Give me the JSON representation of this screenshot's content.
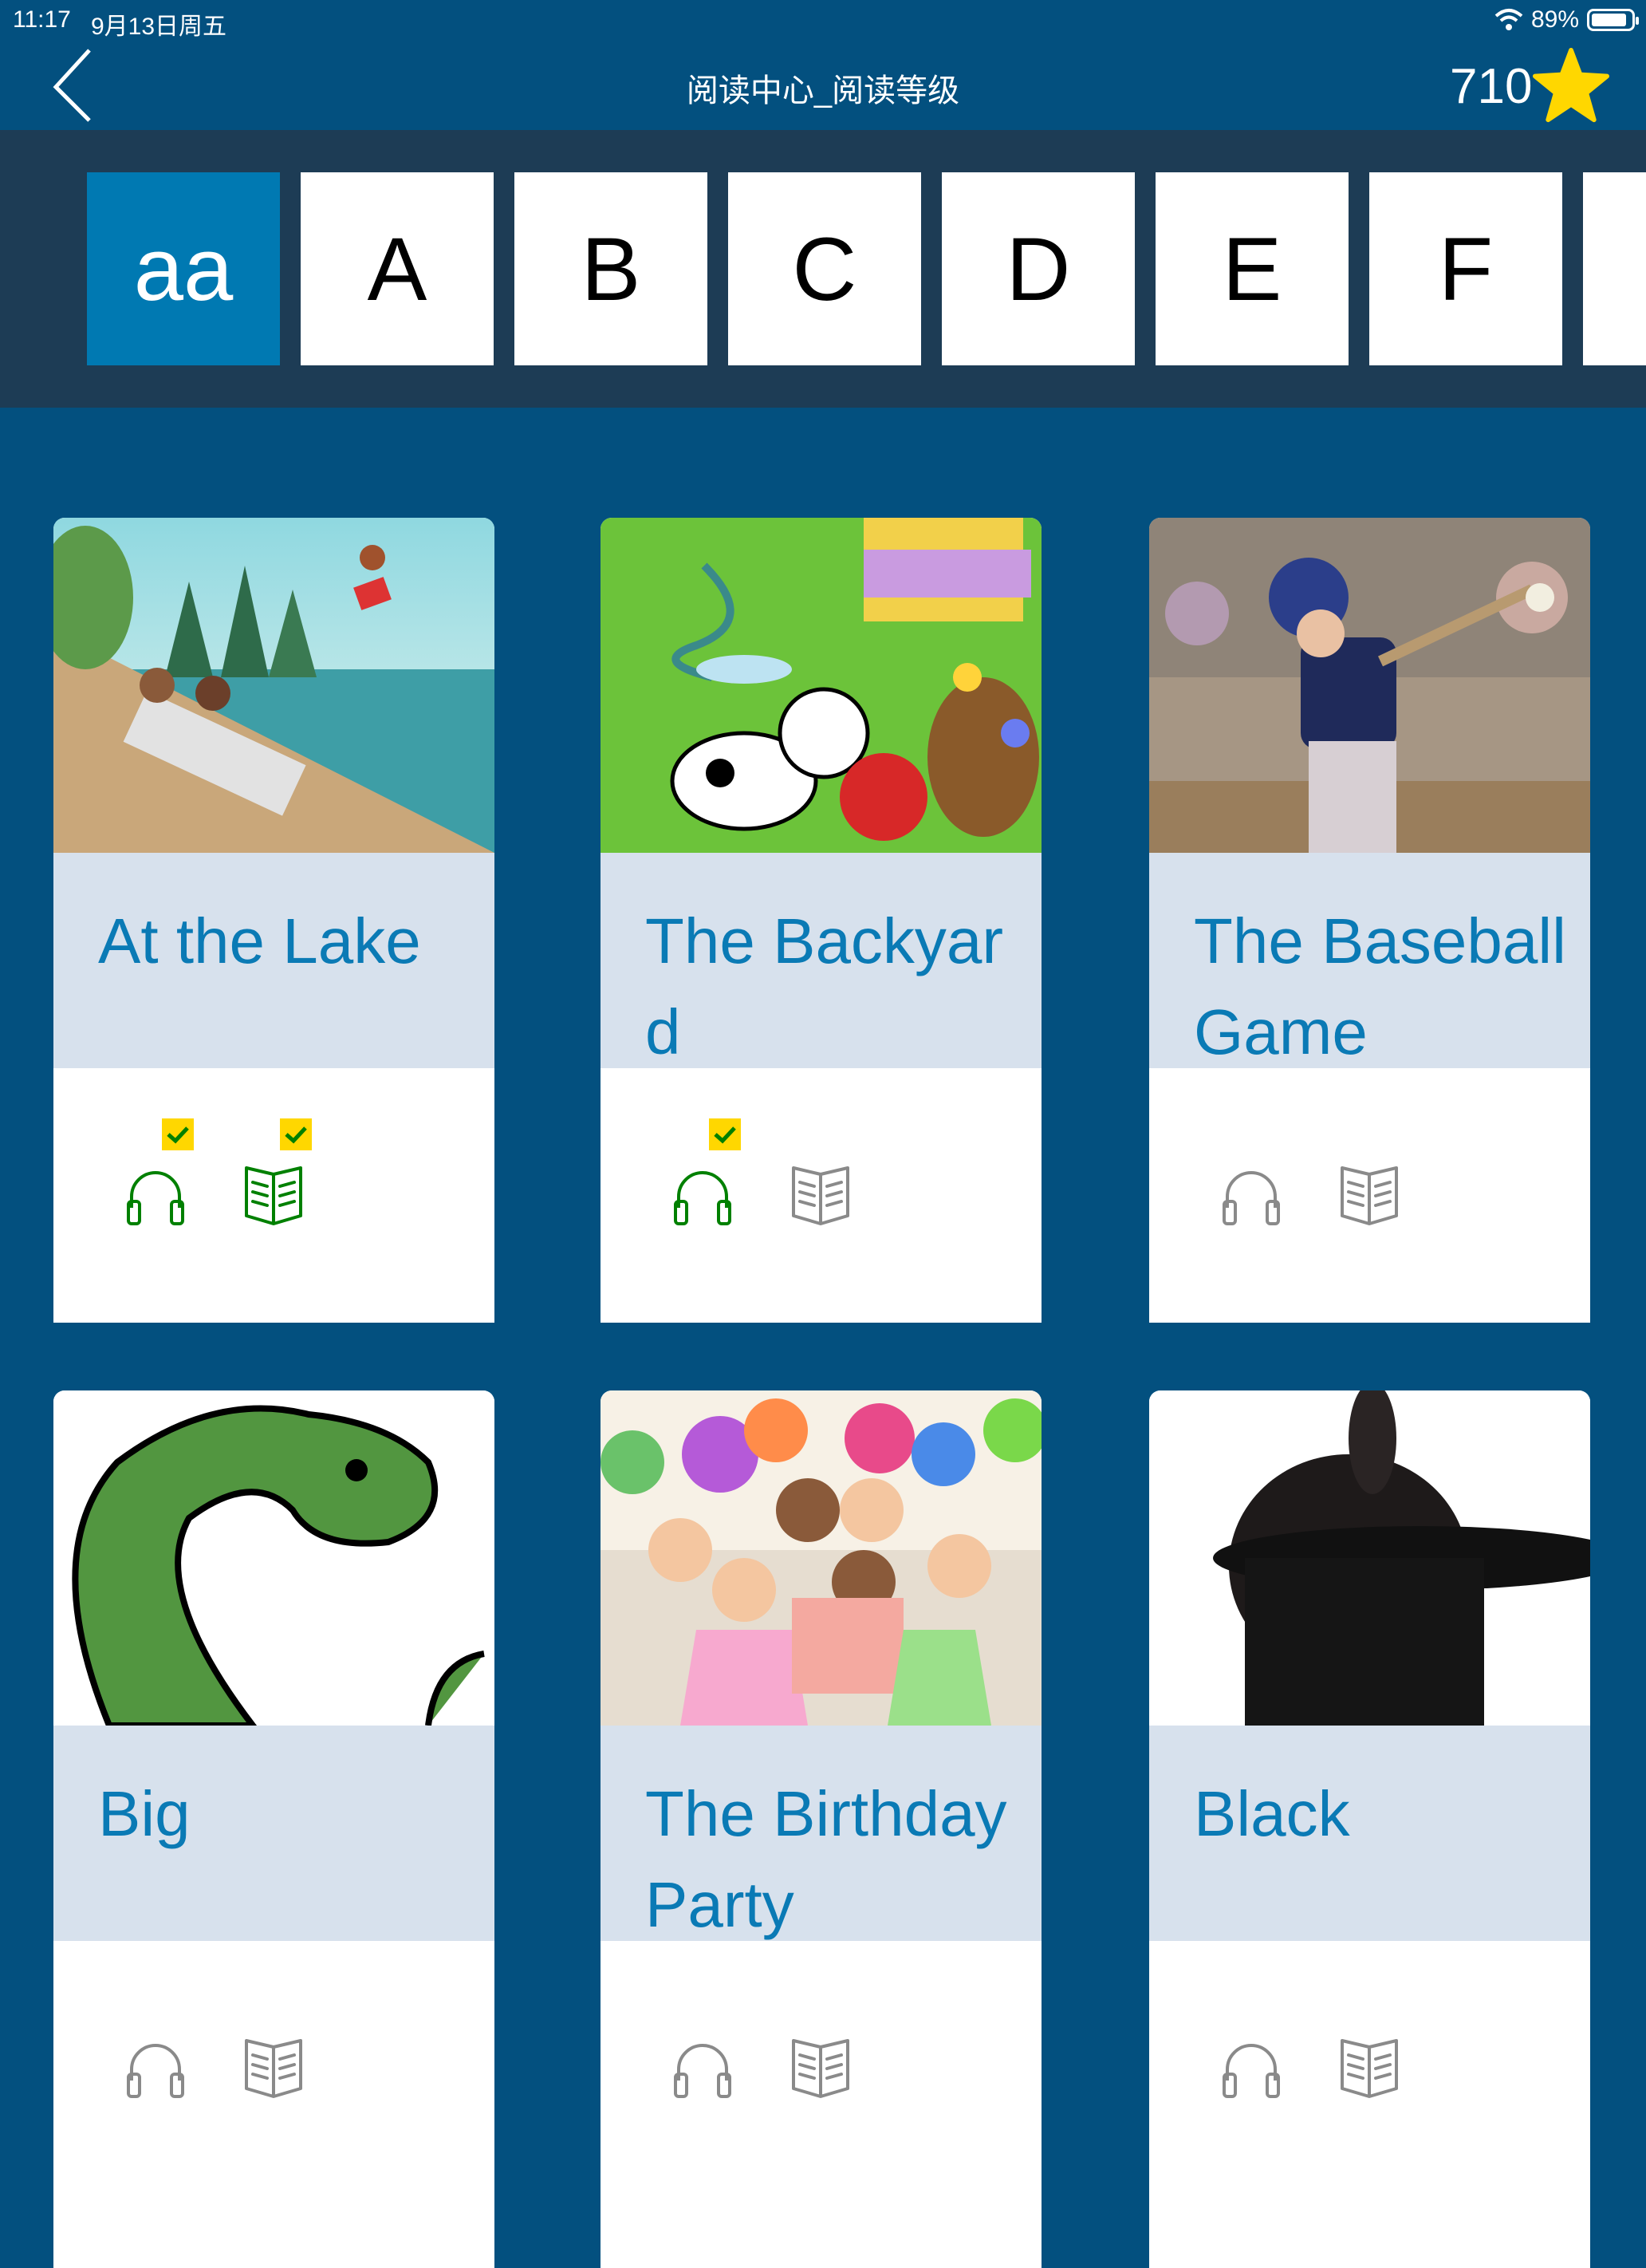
{
  "status_bar": {
    "time": "11:17",
    "date": "9月13日周五",
    "battery": "89%",
    "battery_level": 0.89
  },
  "nav": {
    "title": "阅读中心_阅读等级",
    "score": "710",
    "back_icon": "chevron-left-icon",
    "score_icon": "star-icon"
  },
  "levels": {
    "selected": "aa",
    "items": [
      "aa",
      "A",
      "B",
      "C",
      "D",
      "E",
      "F",
      ""
    ]
  },
  "colors": {
    "nav_bg": "#03507f",
    "level_bar": "#1d3c55",
    "selected_tile": "#0079b2",
    "title_bg": "#d7e1ed",
    "title_text": "#0a7ab5",
    "done": "#008000",
    "pending": "#8a8a8a",
    "badge": "#ffd700",
    "star": "#ffd700"
  },
  "books": [
    {
      "title": "At the Lake",
      "listened": true,
      "read": true
    },
    {
      "title": "The Backyard",
      "listened": true,
      "read": false
    },
    {
      "title": "The Baseball Game",
      "listened": false,
      "read": false
    },
    {
      "title": "Big",
      "listened": false,
      "read": false
    },
    {
      "title": "The Birthday Party",
      "listened": false,
      "read": false
    },
    {
      "title": "Black",
      "listened": false,
      "read": false
    }
  ]
}
